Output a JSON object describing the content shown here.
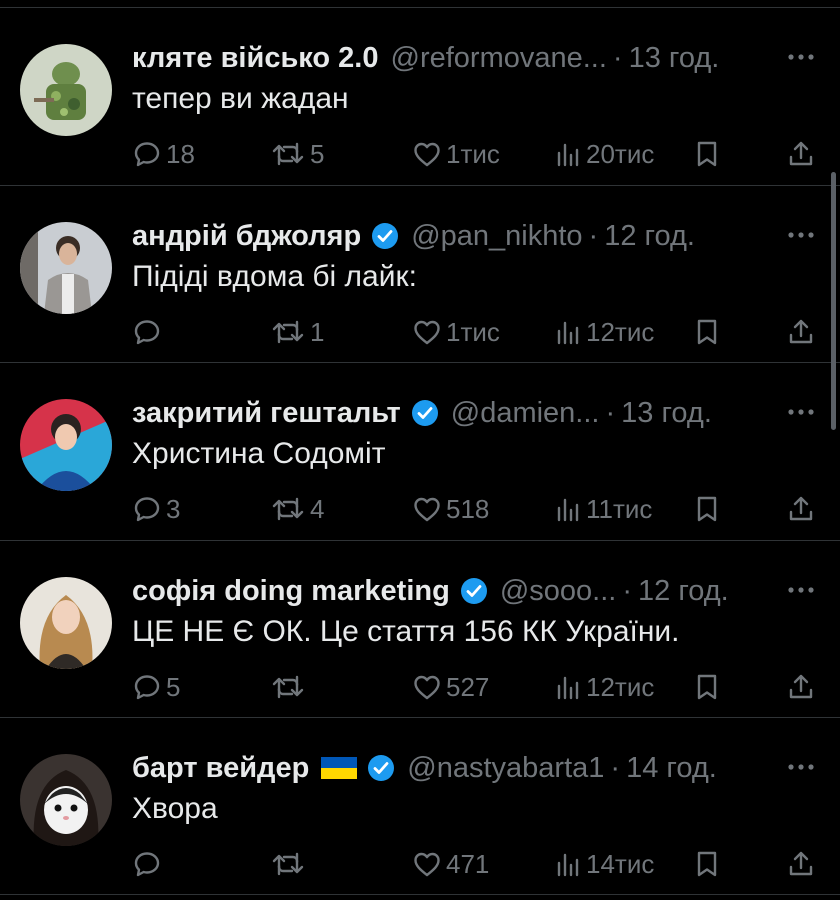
{
  "tweets": [
    {
      "name": "кляте військо 2.0",
      "handle": "@reformovane...",
      "time": "13 год.",
      "text": "тепер ви жадан",
      "verified": false,
      "flag": false,
      "replies": "18",
      "reposts": "5",
      "likes": "1тис",
      "views": "20тис"
    },
    {
      "name": "андрій бджоляр",
      "handle": "@pan_nikhto",
      "time": "12 год.",
      "text": "Підіді вдома бі лайк:",
      "verified": true,
      "flag": false,
      "replies": "",
      "reposts": "1",
      "likes": "1тис",
      "views": "12тис"
    },
    {
      "name": "закритий гештальт",
      "handle": "@damien...",
      "time": "13 год.",
      "text": "Христина Содоміт",
      "verified": true,
      "flag": false,
      "replies": "3",
      "reposts": "4",
      "likes": "518",
      "views": "11тис"
    },
    {
      "name": "софія doing marketing",
      "handle": "@sooo...",
      "time": "12 год.",
      "text": "ЦЕ НЕ Є ОК. Це стаття 156 КК України.",
      "verified": true,
      "flag": false,
      "replies": "5",
      "reposts": "",
      "likes": "527",
      "views": "12тис"
    },
    {
      "name": "барт вейдер",
      "handle": "@nastyabarta1",
      "time": "14 год.",
      "text": "Хвора",
      "verified": true,
      "flag": true,
      "replies": "",
      "reposts": "",
      "likes": "471",
      "views": "14тис"
    }
  ],
  "icons": {
    "reply": "reply-icon",
    "repost": "repost-icon",
    "like": "heart-icon",
    "views": "views-icon",
    "bookmark": "bookmark-icon",
    "share": "share-icon",
    "more": "more-icon",
    "verified": "verified-badge-icon",
    "flag": "ukraine-flag-icon"
  },
  "colors": {
    "background": "#000000",
    "text": "#e7e9ea",
    "muted": "#71767b",
    "verified": "#1d9bf0",
    "divider": "#2f3336",
    "flag_blue": "#0057b7",
    "flag_yellow": "#ffd700"
  }
}
